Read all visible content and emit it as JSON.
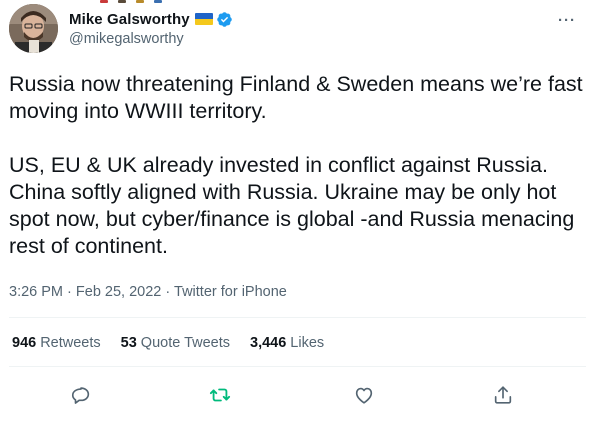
{
  "author": {
    "display_name": "Mike Galsworthy",
    "handle": "@mikegalsworthy",
    "flag_colors": [
      "#1f64c8",
      "#f4c81c"
    ],
    "verified_color": "#1d9bf0"
  },
  "tweet": {
    "text": "Russia now threatening Finland & Sweden means we’re fast moving into WWIII territory.\n\nUS, EU & UK already invested in conflict against Russia. China softly aligned with Russia. Ukraine may be only hot spot now, but cyber/finance is global -and Russia menacing rest of continent.",
    "time": "3:26 PM",
    "separator": "·",
    "date": "Feb 25, 2022",
    "source": "Twitter for iPhone"
  },
  "stats": {
    "retweets_count": "946",
    "retweets_label": "Retweets",
    "quotes_count": "53",
    "quotes_label": "Quote Tweets",
    "likes_count": "3,446",
    "likes_label": "Likes"
  },
  "actions": {
    "more_label": "···",
    "icons": [
      "reply-icon",
      "retweet-icon",
      "like-icon",
      "share-icon"
    ],
    "retweet_color": "#00ba7c",
    "icon_color": "#536471"
  }
}
